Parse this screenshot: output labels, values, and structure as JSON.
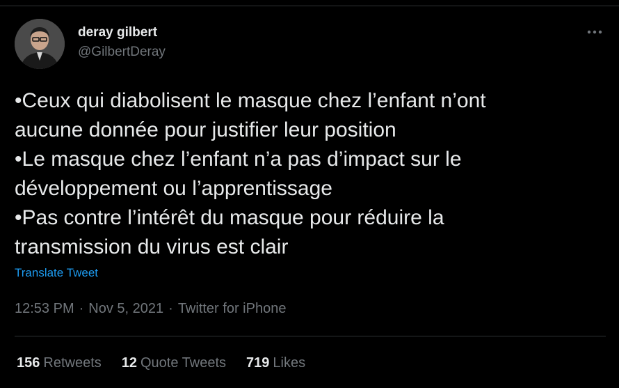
{
  "author": {
    "display_name": "deray gilbert",
    "handle": "@GilbertDeray",
    "avatar_icon": "avatar-photo"
  },
  "tweet": {
    "lines": [
      "•Ceux qui diabolisent le masque chez l’enfant n’ont",
      "aucune donnée pour justifier leur position",
      "•Le masque chez l’enfant n’a pas d’impact sur le",
      "développement ou l’apprentissage",
      "•Pas contre l’intérêt du masque pour réduire la",
      "transmission du virus est clair"
    ],
    "translate_label": "Translate Tweet"
  },
  "meta": {
    "time": "12:53 PM",
    "separator": "·",
    "date": "Nov 5, 2021",
    "source": "Twitter for iPhone"
  },
  "stats": {
    "retweets_count": "156",
    "retweets_label": "Retweets",
    "quote_count": "12",
    "quote_label": "Quote Tweets",
    "likes_count": "719",
    "likes_label": "Likes"
  },
  "colors": {
    "background": "#000000",
    "text_primary": "#e7e9ea",
    "text_secondary": "#71767b",
    "link": "#1d9bf0",
    "border": "#2f3336"
  },
  "icons": {
    "more": "more-horizontal-icon"
  }
}
